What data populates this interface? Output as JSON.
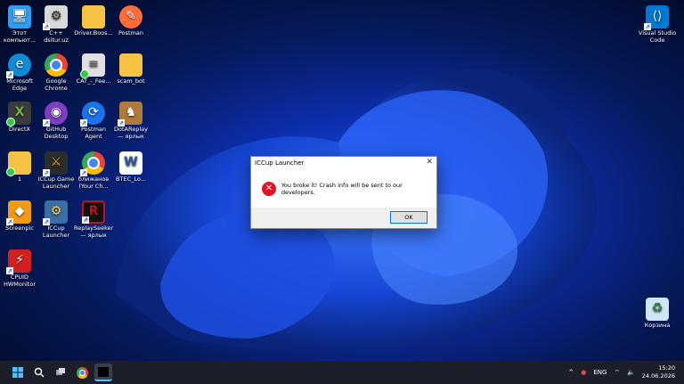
{
  "desktop_icons": [
    {
      "label": "Этот компьют...",
      "icon": "computer-icon",
      "color": "#2a9df4"
    },
    {
      "label": "C++ dsitur.uz",
      "icon": "file-icon",
      "color": "#d9d9d9"
    },
    {
      "label": "Driver.Boos...",
      "icon": "folder-icon",
      "color": "#f5c242"
    },
    {
      "label": "Postman",
      "icon": "postman-icon",
      "color": "#ff6c37"
    },
    {
      "label": "Microsoft Edge",
      "icon": "edge-icon",
      "color": "#0f8ad4"
    },
    {
      "label": "Google Chrome",
      "icon": "chrome-icon",
      "color": "#34a853"
    },
    {
      "label": "CAT_-_Fee...",
      "icon": "document-icon",
      "color": "#e0e0e0"
    },
    {
      "label": "scam_bot",
      "icon": "folder-icon",
      "color": "#f5c242"
    },
    {
      "label": "DirectX",
      "icon": "directx-icon",
      "color": "#6cb33f"
    },
    {
      "label": "GitHub Desktop",
      "icon": "github-icon",
      "color": "#7b3fbf"
    },
    {
      "label": "Postman Agent",
      "icon": "postman-agent-icon",
      "color": "#1a73e8"
    },
    {
      "label": "DotAReplay — ярлык",
      "icon": "dotareplay-icon",
      "color": "#b07a3a"
    },
    {
      "label": "1",
      "icon": "folder-icon",
      "color": "#f5c242"
    },
    {
      "label": "ICCup Game Launcher",
      "icon": "iccup-icon",
      "color": "#b08a30"
    },
    {
      "label": "ближанов (Your Ch...",
      "icon": "chrome-icon",
      "color": "#34a853"
    },
    {
      "label": "BTEC_Lo...",
      "icon": "word-icon",
      "color": "#2b579a"
    },
    {
      "label": "Screenpic",
      "icon": "screenpic-icon",
      "color": "#f39c12"
    },
    {
      "label": "ICCup Launcher",
      "icon": "iccup-launcher-icon",
      "color": "#3a6ea5"
    },
    {
      "label": "ReplaySeeker — ярлык",
      "icon": "replayseeker-icon",
      "color": "#c0141c"
    },
    {
      "label": "CPUID HWMonitor",
      "icon": "hwmonitor-icon",
      "color": "#d02020"
    },
    {
      "label": "Visual Studio Code",
      "icon": "vscode-icon",
      "color": "#0078d4"
    },
    {
      "label": "Корзина",
      "icon": "recycle-bin-icon",
      "color": "#cfe6f7"
    }
  ],
  "dialog": {
    "title": "ICCup Launcher",
    "message": "You broke it! Crash info will be sent to our developers.",
    "ok_label": "OK",
    "close_glyph": "✕",
    "error_glyph": "✕"
  },
  "taskbar": {
    "language": "ENG",
    "time": "15:20",
    "date": "24.06.2026",
    "tray_chevron": "^"
  },
  "colors": {
    "accent": "#0078d7",
    "error": "#e81123",
    "taskbar_bg": "#1c1f2a"
  }
}
